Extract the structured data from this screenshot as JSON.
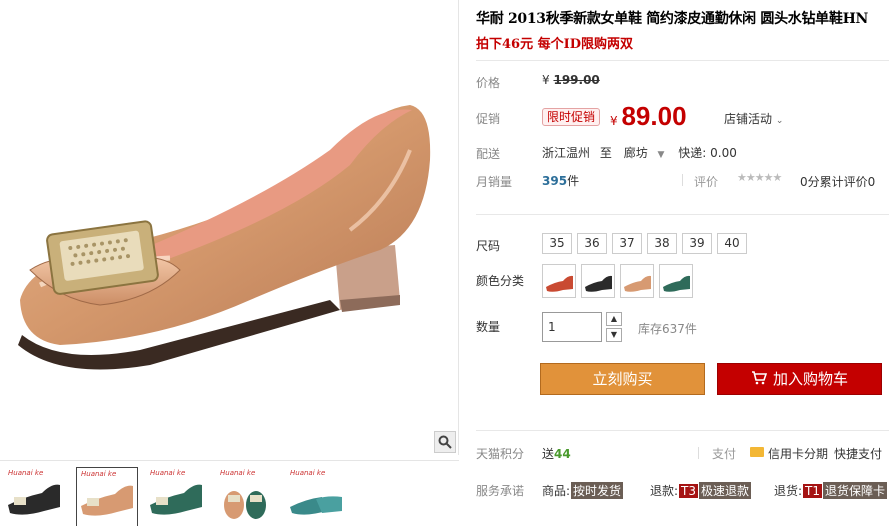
{
  "product": {
    "title": "华耐 2013秋季新款女单鞋 简约漆皮通勤休闲 圆头水钻单鞋HN",
    "subtitle": "拍下46元 每个ID限购两双"
  },
  "price": {
    "label": "价格",
    "currency": "¥",
    "original": "199.00"
  },
  "promo": {
    "label": "促销",
    "tag": "限时促销",
    "currency": "¥",
    "price": "89.00",
    "shop_activity": "店铺活动"
  },
  "shipping": {
    "label": "配送",
    "from": "浙江温州",
    "to_word": "至",
    "dest": "廊坊",
    "fee": "快递: 0.00"
  },
  "sales": {
    "label": "月销量",
    "count": "395",
    "unit": "件",
    "rating_label": "评价",
    "stars": "★★★★★",
    "review_count": "0分累计评价0"
  },
  "size": {
    "label": "尺码",
    "options": [
      "35",
      "36",
      "37",
      "38",
      "39",
      "40"
    ]
  },
  "color": {
    "label": "颜色分类",
    "swatches": [
      "red",
      "black",
      "nude",
      "green"
    ]
  },
  "quantity": {
    "label": "数量",
    "value": "1",
    "up": "▲",
    "down": "▼",
    "stock": "库存637件"
  },
  "actions": {
    "buy": "立刻购买",
    "cart": "加入购物车"
  },
  "points": {
    "label": "天猫积分",
    "value_prefix": "送",
    "value": "44",
    "pay_label": "支付",
    "card": "信用卡分期",
    "quick": "快捷支付"
  },
  "service": {
    "label": "服务承诺",
    "items": [
      {
        "prefix": "商品:",
        "tag": "按时发货"
      },
      {
        "prefix": "退款:",
        "tag_lead": "T3",
        "tag": "极速退款"
      },
      {
        "prefix": "退货:",
        "tag_lead": "T1",
        "tag": "退货保障卡"
      }
    ]
  },
  "gallery": {
    "thumb_brand": "Huanai ke",
    "colors": {
      "nude": "#d79a72",
      "black": "#2a2a2a",
      "green": "#2f6b5a",
      "red": "#c94a32",
      "accent_red": "#c40000",
      "accent_orange": "#e1923a"
    }
  }
}
